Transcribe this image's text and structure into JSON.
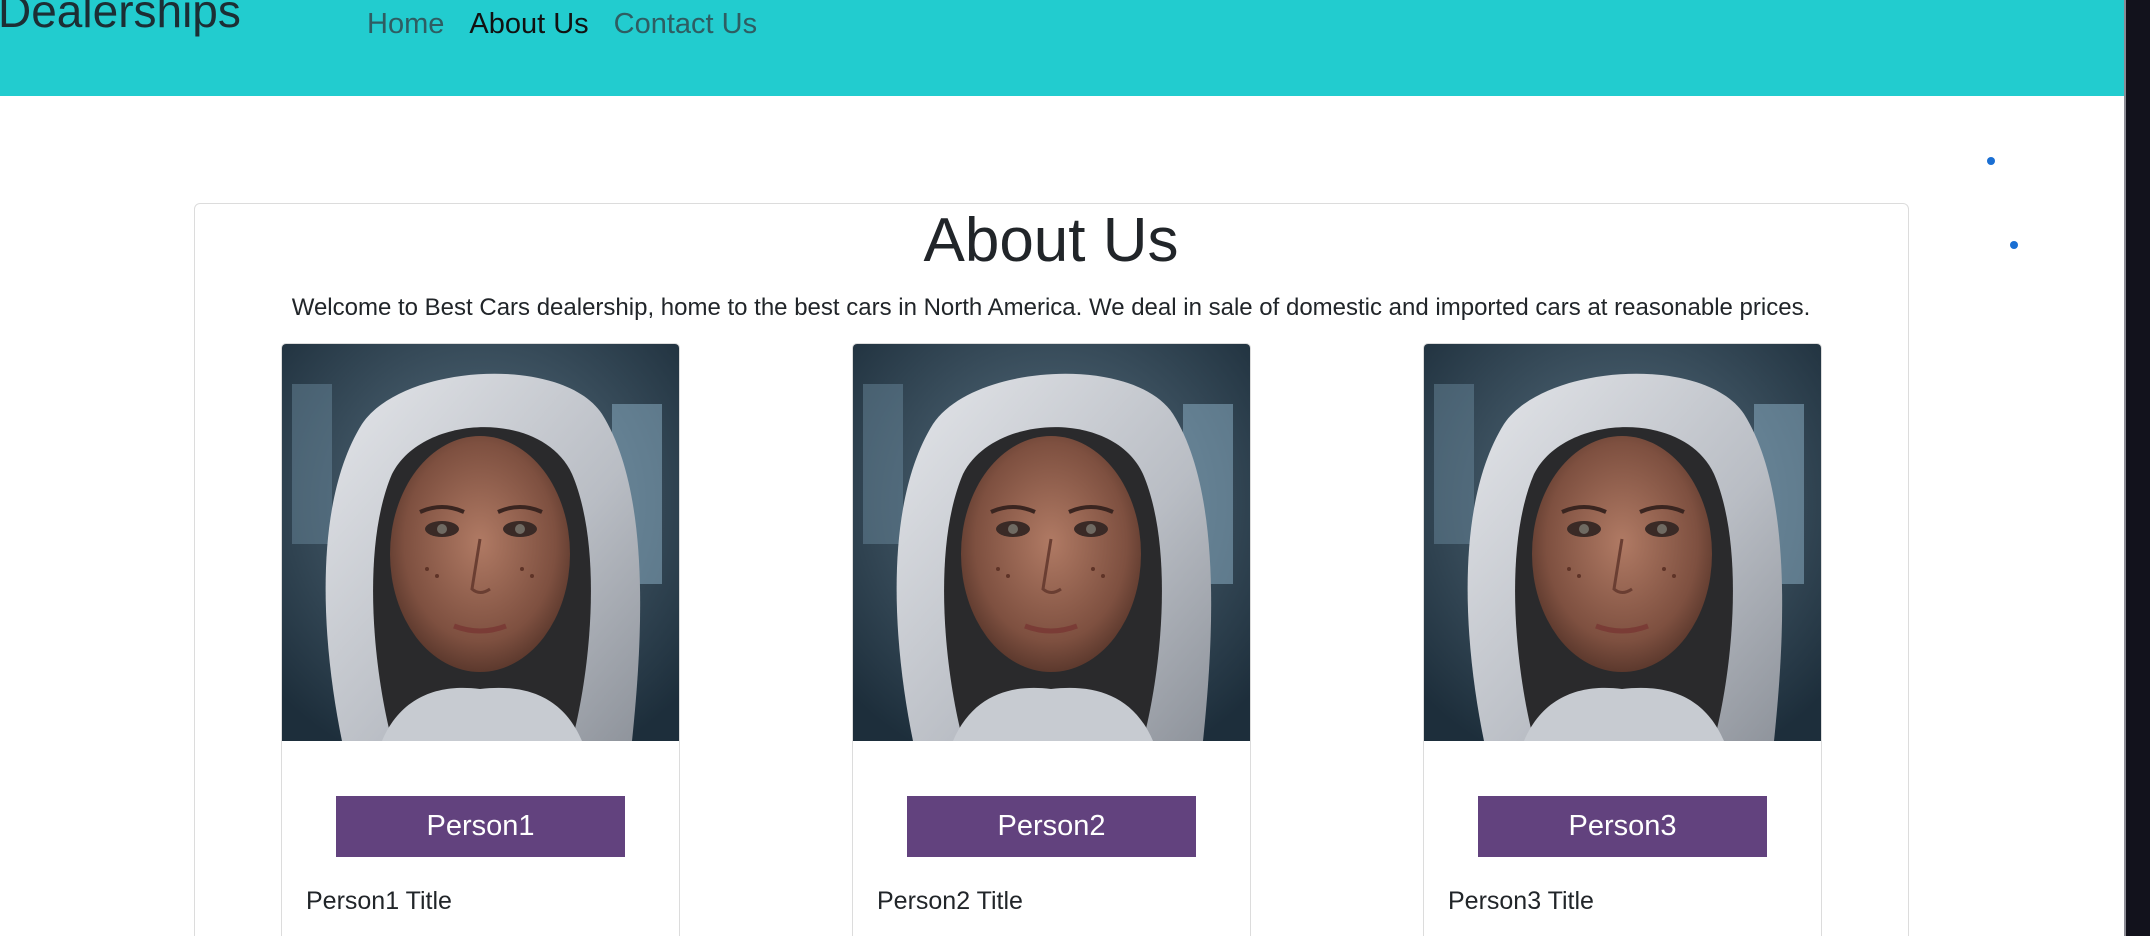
{
  "navbar": {
    "brand": "Dealerships",
    "links": [
      {
        "label": "Home"
      },
      {
        "label": "About Us",
        "active": true
      },
      {
        "label": "Contact Us"
      }
    ],
    "background": "#22cccf"
  },
  "page": {
    "title": "About Us",
    "intro": "Welcome to Best Cars dealership, home to the best cars in North America. We deal in sale of domestic and imported cars at reasonable prices."
  },
  "people": [
    {
      "name": "Person1",
      "title": "Person1 Title",
      "photo": "person-photo"
    },
    {
      "name": "Person2",
      "title": "Person2 Title",
      "photo": "person-photo"
    },
    {
      "name": "Person3",
      "title": "Person3 Title",
      "photo": "person-photo"
    }
  ],
  "colors": {
    "accent": "#62427e",
    "navbar": "#22cccf"
  }
}
